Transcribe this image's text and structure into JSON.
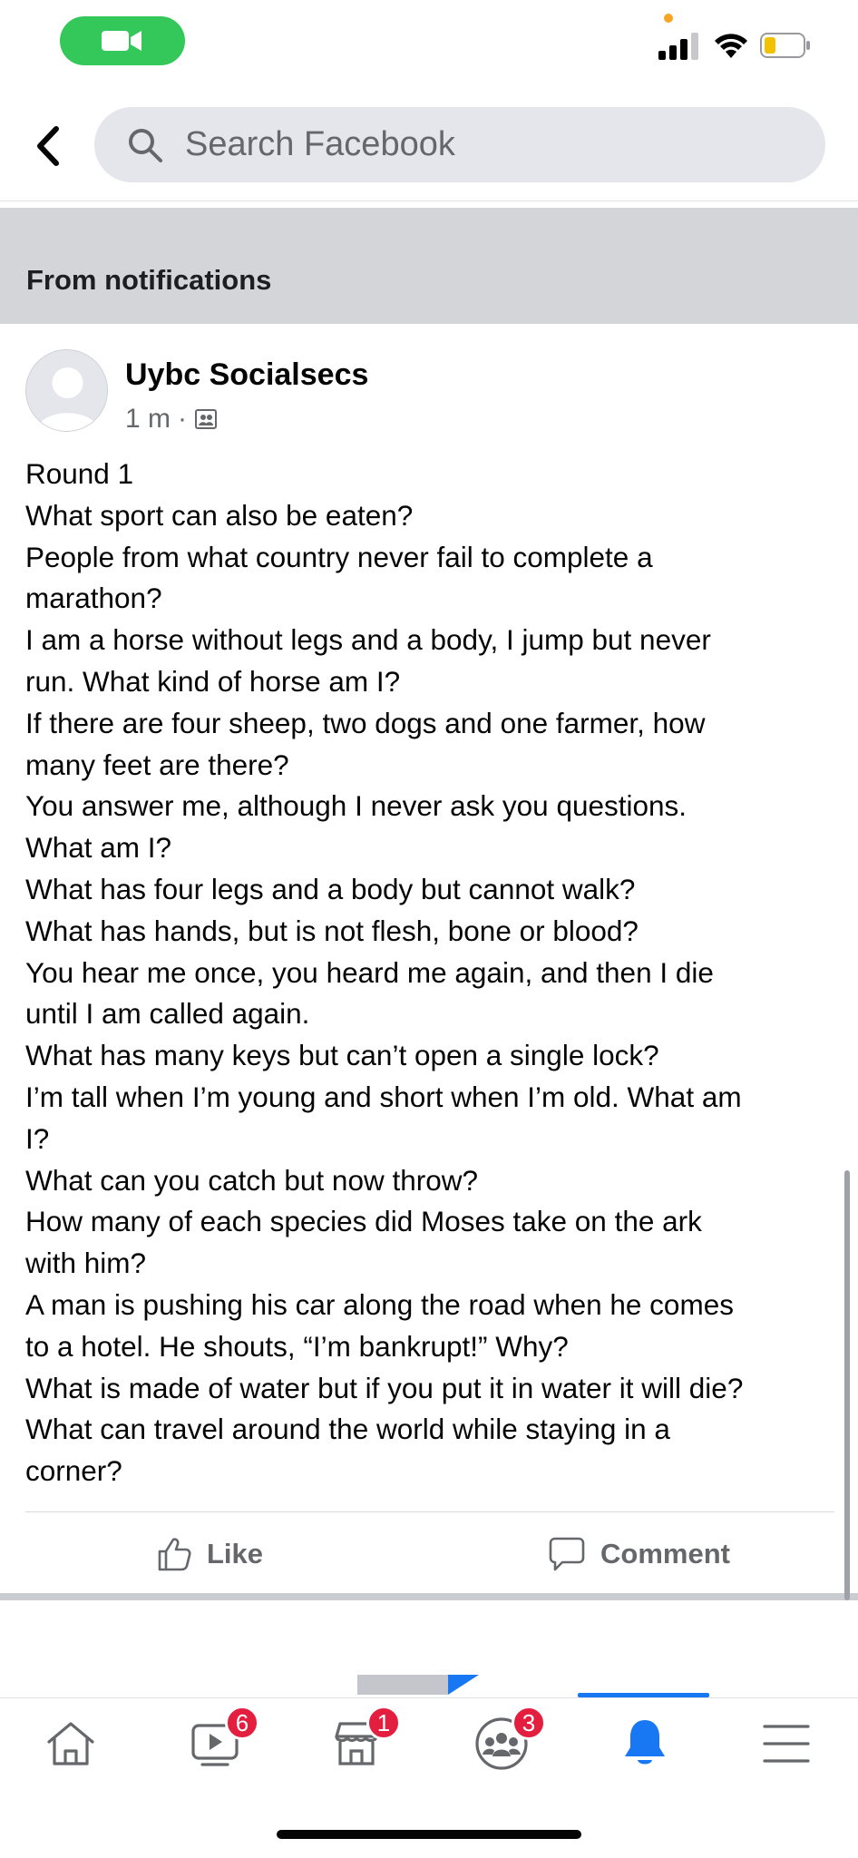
{
  "status_bar": {
    "camera": "video-camera-icon",
    "signal": "signal-bars-icon",
    "wifi": "wifi-icon",
    "battery": "battery-low-icon",
    "pill_color": "#34c759"
  },
  "header": {
    "back_icon": "chevron-left-icon",
    "search_placeholder": "Search Facebook"
  },
  "notification_band": {
    "label": "From notifications"
  },
  "post": {
    "author": "Uybc Socialsecs",
    "time": "1 m",
    "separator": "·",
    "audience_icon": "group-audience-icon",
    "lines": [
      "Round 1",
      "What sport can also be eaten?",
      "People from what country never fail to complete a",
      "marathon?",
      "I am a horse without legs and a body, I jump but never",
      "run. What kind of horse am I?",
      "If there are four sheep, two dogs and one farmer, how",
      "many feet are there?",
      "You answer me, although I never ask you questions.",
      "What am I?",
      "What has four legs and a body but cannot walk?",
      "What has hands, but is not flesh, bone or blood?",
      "You hear me once, you heard me again, and then I die",
      "until I am called again.",
      "What has many keys but can’t open a single lock?",
      "I’m tall when I’m young and short when I’m old. What am",
      "I?",
      "What can you catch but now throw?",
      "How many of each species did Moses take on the ark",
      "with him?",
      "A man is pushing his car along the road when he comes",
      "to a hotel. He shouts, “I’m bankrupt!” Why?",
      "What is made of water but if you put it in water it will die?",
      "What can travel around the world while staying in a",
      "corner?"
    ],
    "actions": {
      "like": "Like",
      "comment": "Comment"
    }
  },
  "tabbar": {
    "tabs": [
      {
        "name": "home",
        "icon": "home-icon",
        "badge": ""
      },
      {
        "name": "watch",
        "icon": "video-play-icon",
        "badge": "6"
      },
      {
        "name": "marketplace",
        "icon": "shop-icon",
        "badge": "1"
      },
      {
        "name": "groups",
        "icon": "groups-icon",
        "badge": "3"
      },
      {
        "name": "notifications",
        "icon": "bell-icon",
        "badge": "",
        "active": true
      },
      {
        "name": "menu",
        "icon": "hamburger-menu-icon",
        "badge": ""
      }
    ]
  },
  "colors": {
    "accent": "#1877f2",
    "badge": "#e41e3f",
    "secondary_text": "#65676b"
  }
}
